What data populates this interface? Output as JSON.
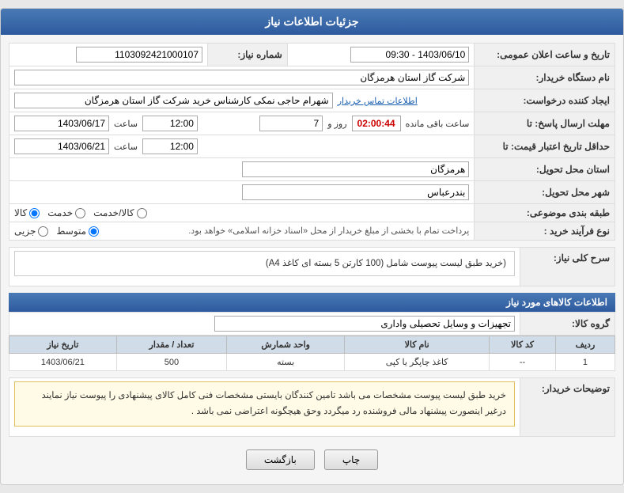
{
  "page": {
    "title": "جزئیات اطلاعات نیاز",
    "fields": {
      "need_number_label": "شماره نیاز:",
      "need_number_value": "1103092421000107",
      "buyer_name_label": "نام دستگاه خریدار:",
      "buyer_name_value": "شرکت گاز استان هرمزگان",
      "creator_label": "ایجاد کننده درخواست:",
      "creator_value": "شهرام حاجی نمکی کارشناس خرید شرکت گاز استان هرمزگان",
      "creator_link": "اطلاعات تماس خریدار",
      "response_deadline_label": "مهلت ارسال پاسخ: تا",
      "response_date": "1403/06/17",
      "response_time": "12:00",
      "response_days": "7",
      "response_days_label": "روز و",
      "response_timer": "02:00:44",
      "response_timer_label": "ساعت باقی مانده",
      "price_deadline_label": "حداقل تاریخ اعتبار قیمت: تا",
      "price_date": "1403/06/21",
      "price_time": "12:00",
      "delivery_province_label": "استان محل تحویل:",
      "delivery_province_value": "هرمزگان",
      "delivery_city_label": "شهر محل تحویل:",
      "delivery_city_value": "بندرعباس",
      "category_label": "طبقه بندی موضوعی:",
      "category_options": [
        "کالا",
        "خدمت",
        "کالا/خدمت"
      ],
      "category_selected": "کالا",
      "purchase_type_label": "نوع فرآیند خرید :",
      "purchase_type_options": [
        "جزیی",
        "متوسط"
      ],
      "purchase_type_selected": "متوسط",
      "purchase_type_note": "پرداخت تمام با بخشی از مبلغ خریدار از محل «اسناد خزانه اسلامی» خواهد بود.",
      "announcement_date_label": "تاریخ و ساعت اعلان عمومی:",
      "announcement_date_value": "1403/06/10 - 09:30"
    },
    "need_desc_header": "سرح کلی نیاز:",
    "need_desc_value": "(خرید طبق لیست پیوست شامل (100 کارتن 5 بسته ای  کاغذ A4)",
    "items_section_header": "اطلاعات کالاهای مورد نیاز",
    "goods_group_label": "گروه کالا:",
    "goods_group_value": "تجهیزات و وسایل تحصیلی واداری",
    "table": {
      "columns": [
        "ردیف",
        "کد کالا",
        "نام کالا",
        "واحد شمارش",
        "تعداد / مقدار",
        "تاریخ نیاز"
      ],
      "rows": [
        {
          "row_num": "1",
          "item_code": "--",
          "item_name": "کاغذ چاپگر یا کپی",
          "unit": "بسته",
          "quantity": "500",
          "need_date": "1403/06/21"
        }
      ]
    },
    "buyer_desc_label": "توضیحات خریدار:",
    "buyer_desc_text": "خرید طبق لیست پیوست مشخصات می باشد تامین  کنندگان بایستی مشخصات فنی کامل کالای پیشنهادی را پیوست نیاز نمایند درغیر اینصورت پیشنهاد مالی فروشنده رد میگردد وحق هیچگونه اعتراضی نمی باشد .",
    "buttons": {
      "back_label": "بازگشت",
      "print_label": "چاپ"
    }
  }
}
